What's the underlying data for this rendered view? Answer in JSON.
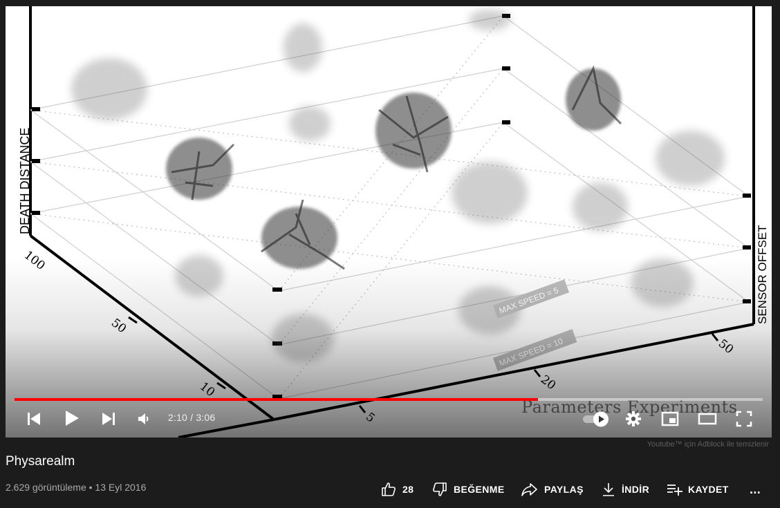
{
  "player": {
    "time_current": "2:10",
    "time_total": "3:06",
    "time_text": "2:10 / 3:06",
    "progress_fraction": 0.7,
    "progress_color": "#ff0000",
    "overlay_title": "Parameters Experiments",
    "labels": {
      "death_distance": "DEATH DISTANCE",
      "sensor_offset": "SENSOR OFFSET",
      "max_speed_5": "MAX SPEED = 5",
      "max_speed_10": "MAX SPEED = 10",
      "ticks_left": [
        "100",
        "50",
        "10"
      ],
      "ticks_right": [
        "5",
        "20",
        "50"
      ]
    },
    "icons": [
      "previous-icon",
      "play-icon",
      "next-icon",
      "volume-icon",
      "autoplay-toggle-icon",
      "settings-gear-icon",
      "miniplayer-icon",
      "theater-mode-icon",
      "fullscreen-icon"
    ]
  },
  "adblock_note": "Youtube™ için Adblock ile temizlenir",
  "video": {
    "title": "Physarealm",
    "meta": "2.629 görüntüleme • 13 Eyl 2016"
  },
  "actions": {
    "like_count": "28",
    "dislike_label": "BEĞENME",
    "share_label": "PAYLAŞ",
    "download_label": "İNDİR",
    "save_label": "KAYDET",
    "more_label": "..."
  }
}
